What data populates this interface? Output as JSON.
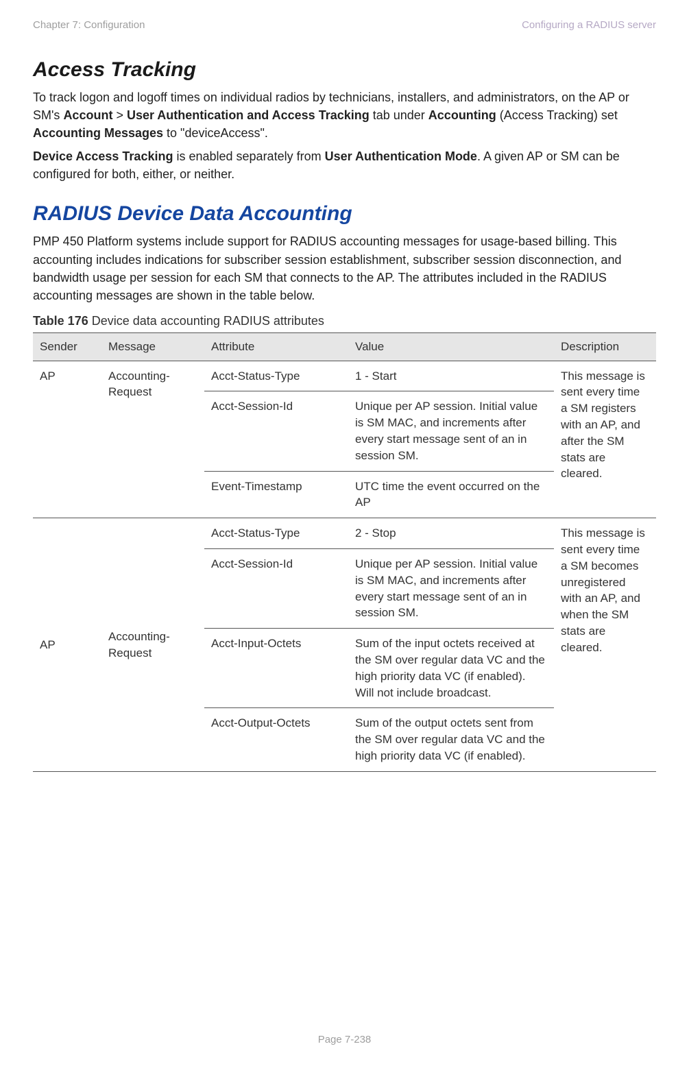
{
  "header": {
    "left": "Chapter 7:  Configuration",
    "right": "Configuring a RADIUS server"
  },
  "section1": {
    "title": "Access Tracking",
    "p1_a": "To track logon and logoff times on individual radios by technicians, installers, and administrators, on the AP or SM's ",
    "p1_b1": "Account",
    "p1_b2": " > ",
    "p1_b3": "User Authentication and Access Tracking",
    "p1_b4": " tab under ",
    "p1_c1": "Accounting",
    "p1_c2": " (Access Tracking) set ",
    "p1_c3": "Accounting Messages",
    "p1_c4": " to \"deviceAccess\".",
    "p2_a": "Device Access Tracking",
    "p2_b": " is enabled separately from ",
    "p2_c": "User Authentication Mode",
    "p2_d": ". A given AP or SM can be configured for both, either, or neither."
  },
  "section2": {
    "title": "RADIUS Device Data Accounting",
    "p1": "PMP 450 Platform systems include support for RADIUS accounting messages for usage-based billing. This accounting includes indications for subscriber session establishment, subscriber session disconnection, and bandwidth usage per session for each SM that connects to the AP. The attributes included in the RADIUS accounting messages are shown in the table below."
  },
  "table": {
    "label": "Table 176",
    "caption": " Device data accounting RADIUS attributes",
    "headers": {
      "sender": "Sender",
      "message": "Message",
      "attribute": "Attribute",
      "value": "Value",
      "description": "Description"
    },
    "group1": {
      "sender": "AP",
      "message": "Accounting-Request",
      "description": "This message is sent every time a SM registers with an AP, and after the SM stats are cleared.",
      "rows": [
        {
          "attr": "Acct-Status-Type",
          "value": "1 - Start"
        },
        {
          "attr": "Acct-Session-Id",
          "value": "Unique per AP session. Initial value is SM MAC, and increments after every start message sent of an in session SM."
        },
        {
          "attr": "Event-Timestamp",
          "value": "UTC time the event occurred on the AP"
        }
      ]
    },
    "group2": {
      "sender": "AP",
      "message": "Accounting-Request",
      "description": "This message is sent every time a SM becomes unregistered with an AP, and when the SM stats are cleared.",
      "rows": [
        {
          "attr": "Acct-Status-Type",
          "value": "2 - Stop"
        },
        {
          "attr": "Acct-Session-Id",
          "value": "Unique per AP session. Initial value is SM MAC, and increments after every start message sent of an in session SM."
        },
        {
          "attr": "Acct-Input-Octets",
          "value": "Sum of the input octets received at the SM over regular data VC and the high priority data VC (if enabled). Will not include broadcast."
        },
        {
          "attr": "Acct-Output-Octets",
          "value": "Sum of the output octets sent from the SM over regular data VC and the high priority data VC (if enabled)."
        }
      ]
    }
  },
  "footer": "Page 7-238"
}
